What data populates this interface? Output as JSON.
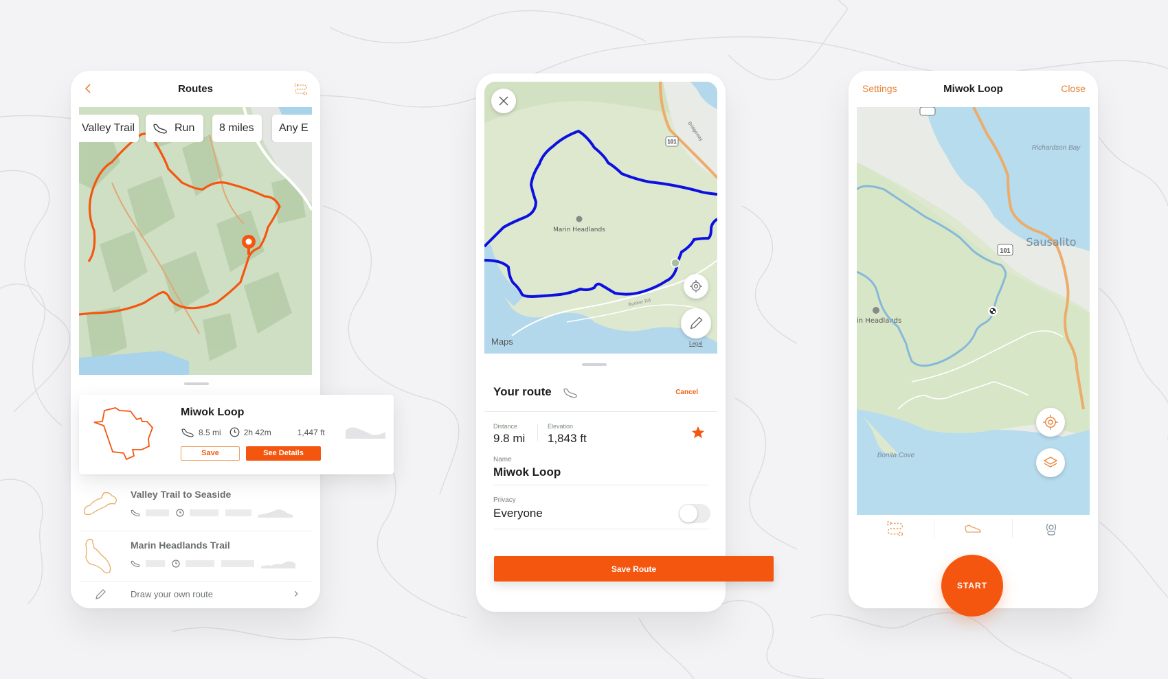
{
  "colors": {
    "accent": "#f5560f",
    "accent_light": "#e8833a",
    "route_blue": "#0d10e0",
    "water": "#b7dcee",
    "park": "#dfe9d2",
    "highway": "#ecac6a"
  },
  "routes_screen": {
    "title": "Routes",
    "back_icon": "chevron-left-icon",
    "route_icon": "route-icon",
    "filters": [
      {
        "label": "Valley Trail",
        "icon": null
      },
      {
        "label": "Run",
        "icon": "shoe-icon"
      },
      {
        "label": "8 miles",
        "icon": null
      },
      {
        "label": "Any E",
        "icon": null
      }
    ],
    "featured": {
      "name": "Miwok Loop",
      "distance": "8.5 mi",
      "duration": "2h 42m",
      "elevation": "1,447 ft",
      "save_label": "Save",
      "details_label": "See Details"
    },
    "list": [
      {
        "name": "Valley Trail to Seaside"
      },
      {
        "name": "Marin Headlands Trail"
      }
    ],
    "draw_label": "Draw your own route"
  },
  "create_screen": {
    "map_label": "Marin Headlands",
    "road_labels": [
      "Bridgeway",
      "Bunker Rd"
    ],
    "highway_shield": "101",
    "attribution": "Maps",
    "legal": "Legal",
    "sheet_title": "Your route",
    "cancel_label": "Cancel",
    "distance_label": "Distance",
    "distance_value": "9.8 mi",
    "elevation_label": "Elevation",
    "elevation_value": "1,843 ft",
    "favorite": true,
    "name_label": "Name",
    "name_value": "Miwok Loop",
    "privacy_label": "Privacy",
    "privacy_value": "Everyone",
    "privacy_toggle_on": false,
    "save_label": "Save Route"
  },
  "record_screen": {
    "settings_label": "Settings",
    "title": "Miwok Loop",
    "close_label": "Close",
    "map_labels": {
      "bay": "Richardson Bay",
      "town": "Sausalito",
      "park": "in Headlands",
      "cove": "Bonita Cove",
      "shield": "101"
    },
    "tabs": [
      {
        "name": "route-icon"
      },
      {
        "name": "shoe-icon"
      },
      {
        "name": "beacon-icon"
      }
    ],
    "start_label": "START"
  }
}
